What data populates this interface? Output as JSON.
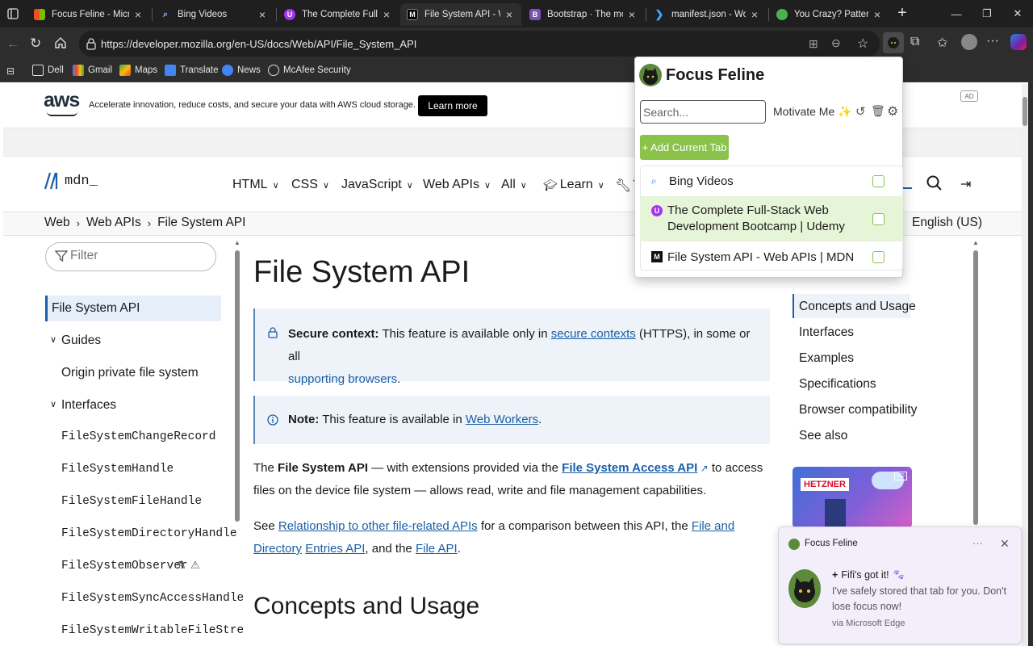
{
  "tabs": [
    {
      "title": "Focus Feline - Microsoft",
      "favicon": "microsoft-icon"
    },
    {
      "title": "Bing Videos",
      "favicon": "search-icon"
    },
    {
      "title": "The Complete Full-Stack",
      "favicon": "udemy-icon"
    },
    {
      "title": "File System API - Web",
      "favicon": "mdn-icon"
    },
    {
      "title": "Bootstrap · The most p",
      "favicon": "bootstrap-icon"
    },
    {
      "title": "manifest.json - Worksp",
      "favicon": "vscode-icon"
    },
    {
      "title": "You Crazy? Patterns wi",
      "favicon": "globe-icon"
    }
  ],
  "address_bar": {
    "url": "https://developer.mozilla.org/en-US/docs/Web/API/File_System_API"
  },
  "bookmarks": [
    "Dell",
    "Gmail",
    "Maps",
    "Translate",
    "News",
    "McAfee Security"
  ],
  "ad_banner": {
    "logo": "aws",
    "text": "Accelerate innovation, reduce costs, and secure your data with AWS cloud storage.",
    "button": "Learn more",
    "badge": "AD"
  },
  "mdn_header": {
    "logo": "mdn_",
    "nav": [
      "HTML",
      "CSS",
      "JavaScript",
      "Web APIs",
      "All",
      "Learn",
      "T"
    ]
  },
  "breadcrumbs": [
    "Web",
    "Web APIs",
    "File System API"
  ],
  "language": "English (US)",
  "sidebar": {
    "filter_placeholder": "Filter",
    "items": [
      {
        "label": "File System API",
        "kind": "active"
      },
      {
        "label": "Guides",
        "kind": "group"
      },
      {
        "label": "Origin private file system",
        "kind": "link"
      },
      {
        "label": "Interfaces",
        "kind": "group"
      },
      {
        "label": "FileSystemChangeRecord",
        "kind": "code"
      },
      {
        "label": "FileSystemHandle",
        "kind": "code"
      },
      {
        "label": "FileSystemFileHandle",
        "kind": "code"
      },
      {
        "label": "FileSystemDirectoryHandle",
        "kind": "code"
      },
      {
        "label": "FileSystemObserver",
        "kind": "code"
      },
      {
        "label": "FileSystemSyncAccessHandle",
        "kind": "code"
      },
      {
        "label": "FileSystemWritableFileStre",
        "kind": "code"
      }
    ]
  },
  "main": {
    "title": "File System API",
    "secure_context": {
      "label": "Secure context:",
      "text1": "This feature is available only in",
      "link1": "secure contexts",
      "text2": "(HTTPS), in some or all",
      "link2": "supporting browsers",
      "text3": "."
    },
    "note": {
      "label": "Note:",
      "text": "This feature is available in",
      "link": "Web Workers",
      "end": "."
    },
    "p1": {
      "pre": "The",
      "bold": "File System API",
      "mid": "— with extensions provided via the",
      "link": "File System Access API",
      "post1": "to access files on",
      "post2": "the device file system — allows read, write and file management capabilities."
    },
    "p2": {
      "pre": "See",
      "link1": "Relationship to other file-related APIs",
      "mid": "for a comparison between this API, the",
      "link2a": "File and Directory",
      "link2b": "Entries API",
      "and": ", and the",
      "link3": "File API",
      "end": "."
    },
    "h2": "Concepts and Usage"
  },
  "toc": [
    "Concepts and Usage",
    "Interfaces",
    "Examples",
    "Specifications",
    "Browser compatibility",
    "See also"
  ],
  "side_ad": {
    "brand": "HETZNER",
    "badge": "AD"
  },
  "popup": {
    "title": "Focus Feline",
    "search_placeholder": "Search...",
    "motivate": "Motivate Me",
    "add_button": "+ Add Current Tab",
    "items": [
      {
        "title": "Bing Videos",
        "icon": "search-icon"
      },
      {
        "title": "The Complete Full-Stack Web Development Bootcamp | Udemy",
        "icon": "udemy-icon"
      },
      {
        "title": "File System API - Web APIs | MDN",
        "icon": "mdn-icon"
      }
    ]
  },
  "toast": {
    "app": "Focus Feline",
    "heading": "Fifi's got it!",
    "body": "I've safely stored that tab for you. Don't lose focus now!",
    "via": "via Microsoft Edge"
  },
  "colors": {
    "accent_green": "#8bc34a",
    "highlight_row": "#e6f4d7",
    "mdn_link": "#1a5fa8"
  }
}
